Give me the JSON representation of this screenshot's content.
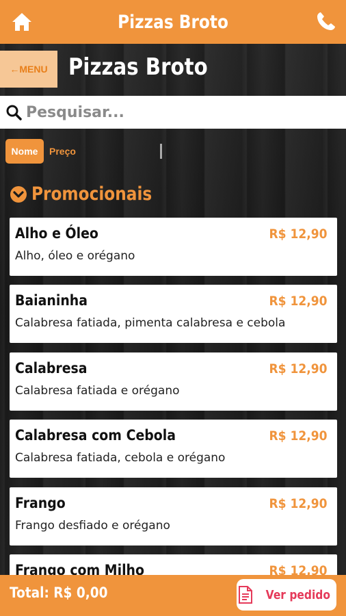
{
  "colors": {
    "accent": "#f0943c",
    "price": "#f0943c",
    "cart_button_text": "#e53a5a"
  },
  "topbar": {
    "title": "Pizzas Broto",
    "left_icon": "home-icon",
    "right_icon": "phone-icon"
  },
  "header": {
    "menu_label": "←MENU",
    "page_title": "Pizzas Broto"
  },
  "search": {
    "placeholder": "Pesquisar...",
    "icon": "search-icon"
  },
  "sort": {
    "by_name": "Nome",
    "by_price": "Preço"
  },
  "category": {
    "icon": "chevron-down-circle-icon",
    "title": "Promocionais"
  },
  "items": [
    {
      "name": "Alho e Óleo",
      "price": "R$ 12,90",
      "description": "Alho, óleo e orégano"
    },
    {
      "name": "Baianinha",
      "price": "R$ 12,90",
      "description": "Calabresa fatiada, pimenta calabresa e cebola"
    },
    {
      "name": "Calabresa",
      "price": "R$ 12,90",
      "description": "Calabresa fatiada e orégano"
    },
    {
      "name": "Calabresa com Cebola",
      "price": "R$ 12,90",
      "description": "Calabresa fatiada, cebola e orégano"
    },
    {
      "name": "Frango",
      "price": "R$ 12,90",
      "description": "Frango desfiado e orégano"
    },
    {
      "name": "Frango com Milho",
      "price": "R$ 12,90",
      "description": ""
    }
  ],
  "footer": {
    "total": "Total: R$ 0,00",
    "cart_label": "Ver pedido",
    "cart_icon": "document-icon"
  }
}
